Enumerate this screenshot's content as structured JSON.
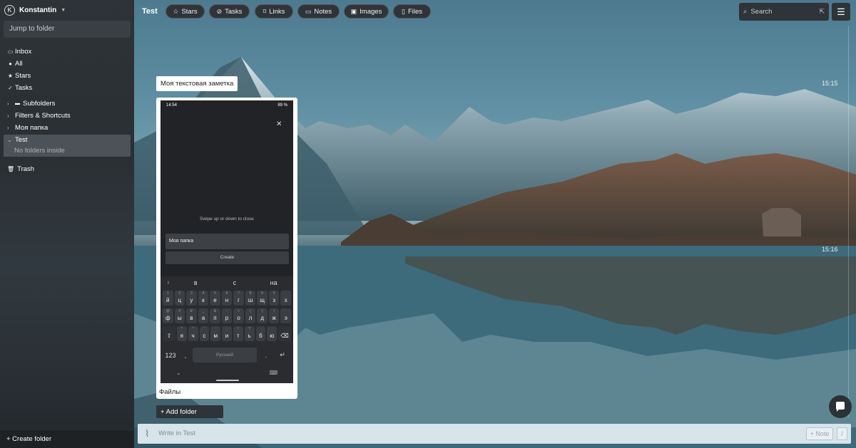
{
  "sidebar": {
    "user": {
      "initial": "K",
      "name": "Konstantin"
    },
    "jump_placeholder": "Jump to folder",
    "nav": [
      {
        "icon": "inbox-icon",
        "label": "Inbox"
      },
      {
        "icon": "all-icon",
        "label": "All"
      },
      {
        "icon": "star-icon",
        "label": "Stars"
      },
      {
        "icon": "check-circle-icon",
        "label": "Tasks"
      }
    ],
    "folders": [
      {
        "label": "Subfolders"
      },
      {
        "label": "Filters & Shortcuts"
      },
      {
        "label": "Моя папка"
      },
      {
        "label": "Test",
        "expanded": true,
        "note": "No folders inside"
      }
    ],
    "trash": "Trash",
    "create_folder": "+ Create folder"
  },
  "topbar": {
    "title": "Test",
    "filters": [
      {
        "icon": "star-icon",
        "label": "Stars"
      },
      {
        "icon": "check-circle-icon",
        "label": "Tasks"
      },
      {
        "icon": "bookmark-icon",
        "label": "Links"
      },
      {
        "icon": "note-icon",
        "label": "Notes"
      },
      {
        "icon": "image-icon",
        "label": "Images"
      },
      {
        "icon": "file-icon",
        "label": "Files"
      }
    ],
    "search_placeholder": "Search"
  },
  "feed": {
    "text_note": "Моя текстовая заметка",
    "time1": "15:15",
    "time2": "15:16",
    "card_caption": "Файлы",
    "add_folder": "+ Add folder"
  },
  "phone": {
    "status_time": "14:54",
    "status_battery": "89 %",
    "swipe_hint": "Swipe up or down to close",
    "input_value": "Моя папка",
    "create_button": "Create",
    "suggestions": [
      "в",
      "с",
      "на"
    ],
    "rows": [
      [
        [
          "й",
          "1"
        ],
        [
          "ц",
          "2"
        ],
        [
          "у",
          "3"
        ],
        [
          "к",
          "4"
        ],
        [
          "е",
          "5"
        ],
        [
          "н",
          "6"
        ],
        [
          "г",
          "7"
        ],
        [
          "ш",
          "8"
        ],
        [
          "щ",
          "9"
        ],
        [
          "з",
          "0"
        ],
        [
          "х",
          ""
        ]
      ],
      [
        [
          "ф",
          "@"
        ],
        [
          "ы",
          "#"
        ],
        [
          "в",
          "₽"
        ],
        [
          "а",
          "_"
        ],
        [
          "п",
          "&"
        ],
        [
          "р",
          "-"
        ],
        [
          "о",
          "+"
        ],
        [
          "л",
          "("
        ],
        [
          "д",
          ")"
        ],
        [
          "ж",
          "/"
        ],
        [
          "э",
          ""
        ]
      ],
      [
        [
          "я",
          "*"
        ],
        [
          "ч",
          "\""
        ],
        [
          "с",
          "'"
        ],
        [
          "м",
          ":"
        ],
        [
          "и",
          ";"
        ],
        [
          "т",
          "!"
        ],
        [
          "ь",
          "?"
        ],
        [
          "б",
          ""
        ],
        [
          "ю",
          ""
        ]
      ]
    ],
    "kb_numeric": "123",
    "kb_comma": ",",
    "kb_space": "Русский",
    "kb_period": "."
  },
  "composer": {
    "placeholder": "Write in Test",
    "note_button": "+ Note",
    "slash_button": "/"
  }
}
